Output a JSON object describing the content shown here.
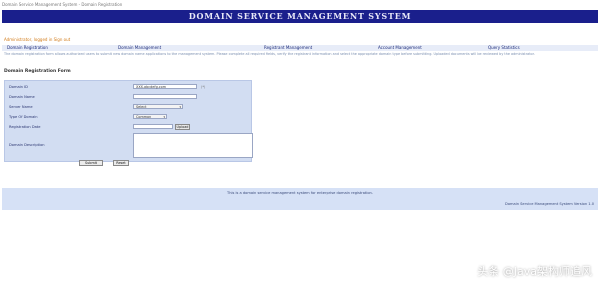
{
  "topbar": {
    "text": "Domain Service Management System - Domain Registration"
  },
  "banner": {
    "title": "DOMAIN SERVICE MANAGEMENT SYSTEM"
  },
  "user": {
    "status": "Administrator, logged in  Sign out"
  },
  "menu": [
    {
      "label": "Domain Registration"
    },
    {
      "label": "Domain Management"
    },
    {
      "label": "Registrant Management"
    },
    {
      "label": "Account Management"
    },
    {
      "label": "Query Statistics"
    }
  ],
  "description": "The domain registration form allows authorized users to submit new domain name applications to the management system. Please complete all required fields, verify the registrant information and select the appropriate domain type before submitting. Uploaded documents will be reviewed by the administrator.",
  "form": {
    "title": "Domain Registration Form",
    "fields": [
      {
        "label": "Domain ID",
        "value": "XXX.abcdefg.com",
        "hint": "(*)"
      },
      {
        "label": "Domain Name",
        "value": ""
      },
      {
        "label": "Server Name",
        "value": "Select"
      },
      {
        "label": "Type Of Domain",
        "value": "Common"
      },
      {
        "label": "Registration Date",
        "value": ""
      },
      {
        "label": "Domain Description",
        "value": ""
      }
    ],
    "upload_label": "Upload",
    "submit_label": "Submit",
    "reset_label": "Reset"
  },
  "footer": {
    "line1": "This is a domain service management system for enterprise domain registration.",
    "line2": "Domain Service Management System Version 1.0"
  },
  "watermark": "头条 @Java架构师追风"
}
